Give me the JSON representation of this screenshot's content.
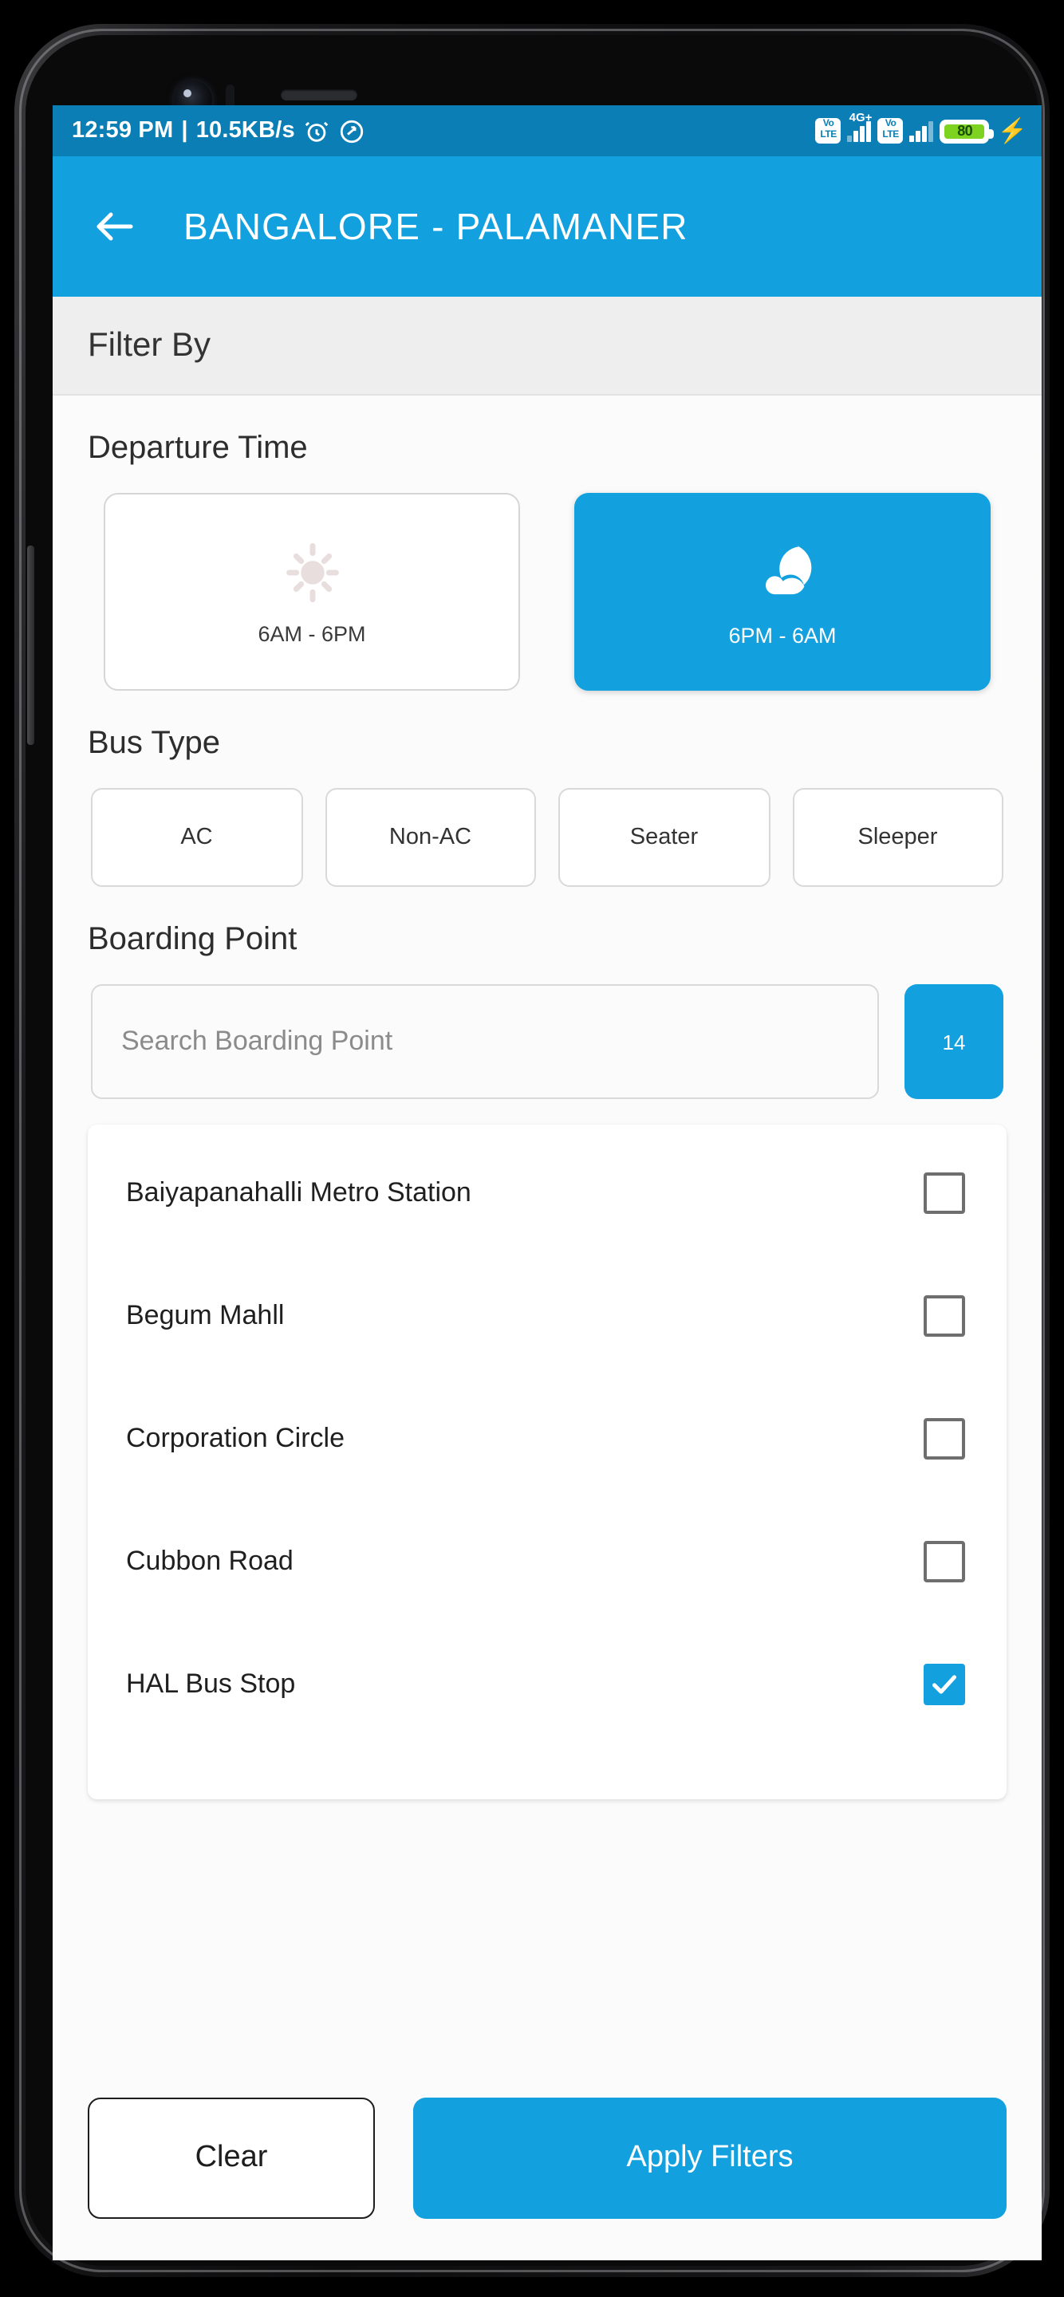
{
  "statusbar": {
    "time": "12:59 PM",
    "separator": "|",
    "network_speed": "10.5KB/s",
    "alarm_icon": "alarm-icon",
    "sync_icon": "sync-disabled-icon",
    "sim1_volte": "VoLTE",
    "sim1_network": "4G+",
    "sim2_volte": "VoLTE",
    "battery_level": "80",
    "charging_icon": "charging-bolt-icon",
    "battery_color": "#7ed321",
    "bar_color": "#0b7fb5"
  },
  "appbar": {
    "back_icon": "back-arrow-icon",
    "title": "BANGALORE - PALAMANER",
    "color": "#12a0df"
  },
  "filter_header": {
    "label": "Filter By"
  },
  "departure": {
    "title": "Departure Time",
    "options": [
      {
        "label": "6AM - 6PM",
        "icon": "sun-icon",
        "selected": false
      },
      {
        "label": "6PM - 6AM",
        "icon": "moon-cloud-icon",
        "selected": true
      }
    ]
  },
  "bus_type": {
    "title": "Bus Type",
    "options": [
      {
        "label": "AC",
        "selected": false
      },
      {
        "label": "Non-AC",
        "selected": false
      },
      {
        "label": "Seater",
        "selected": false
      },
      {
        "label": "Sleeper",
        "selected": false
      }
    ]
  },
  "boarding": {
    "title": "Boarding Point",
    "search_placeholder": "Search Boarding Point",
    "search_value": "",
    "count_badge": "14",
    "items": [
      {
        "label": "Baiyapanahalli Metro Station",
        "checked": false
      },
      {
        "label": "Begum Mahll",
        "checked": false
      },
      {
        "label": "Corporation Circle",
        "checked": false
      },
      {
        "label": "Cubbon Road",
        "checked": false
      },
      {
        "label": "HAL Bus Stop",
        "checked": true
      }
    ]
  },
  "actions": {
    "clear_label": "Clear",
    "apply_label": "Apply Filters",
    "accent_color": "#12a0df"
  }
}
